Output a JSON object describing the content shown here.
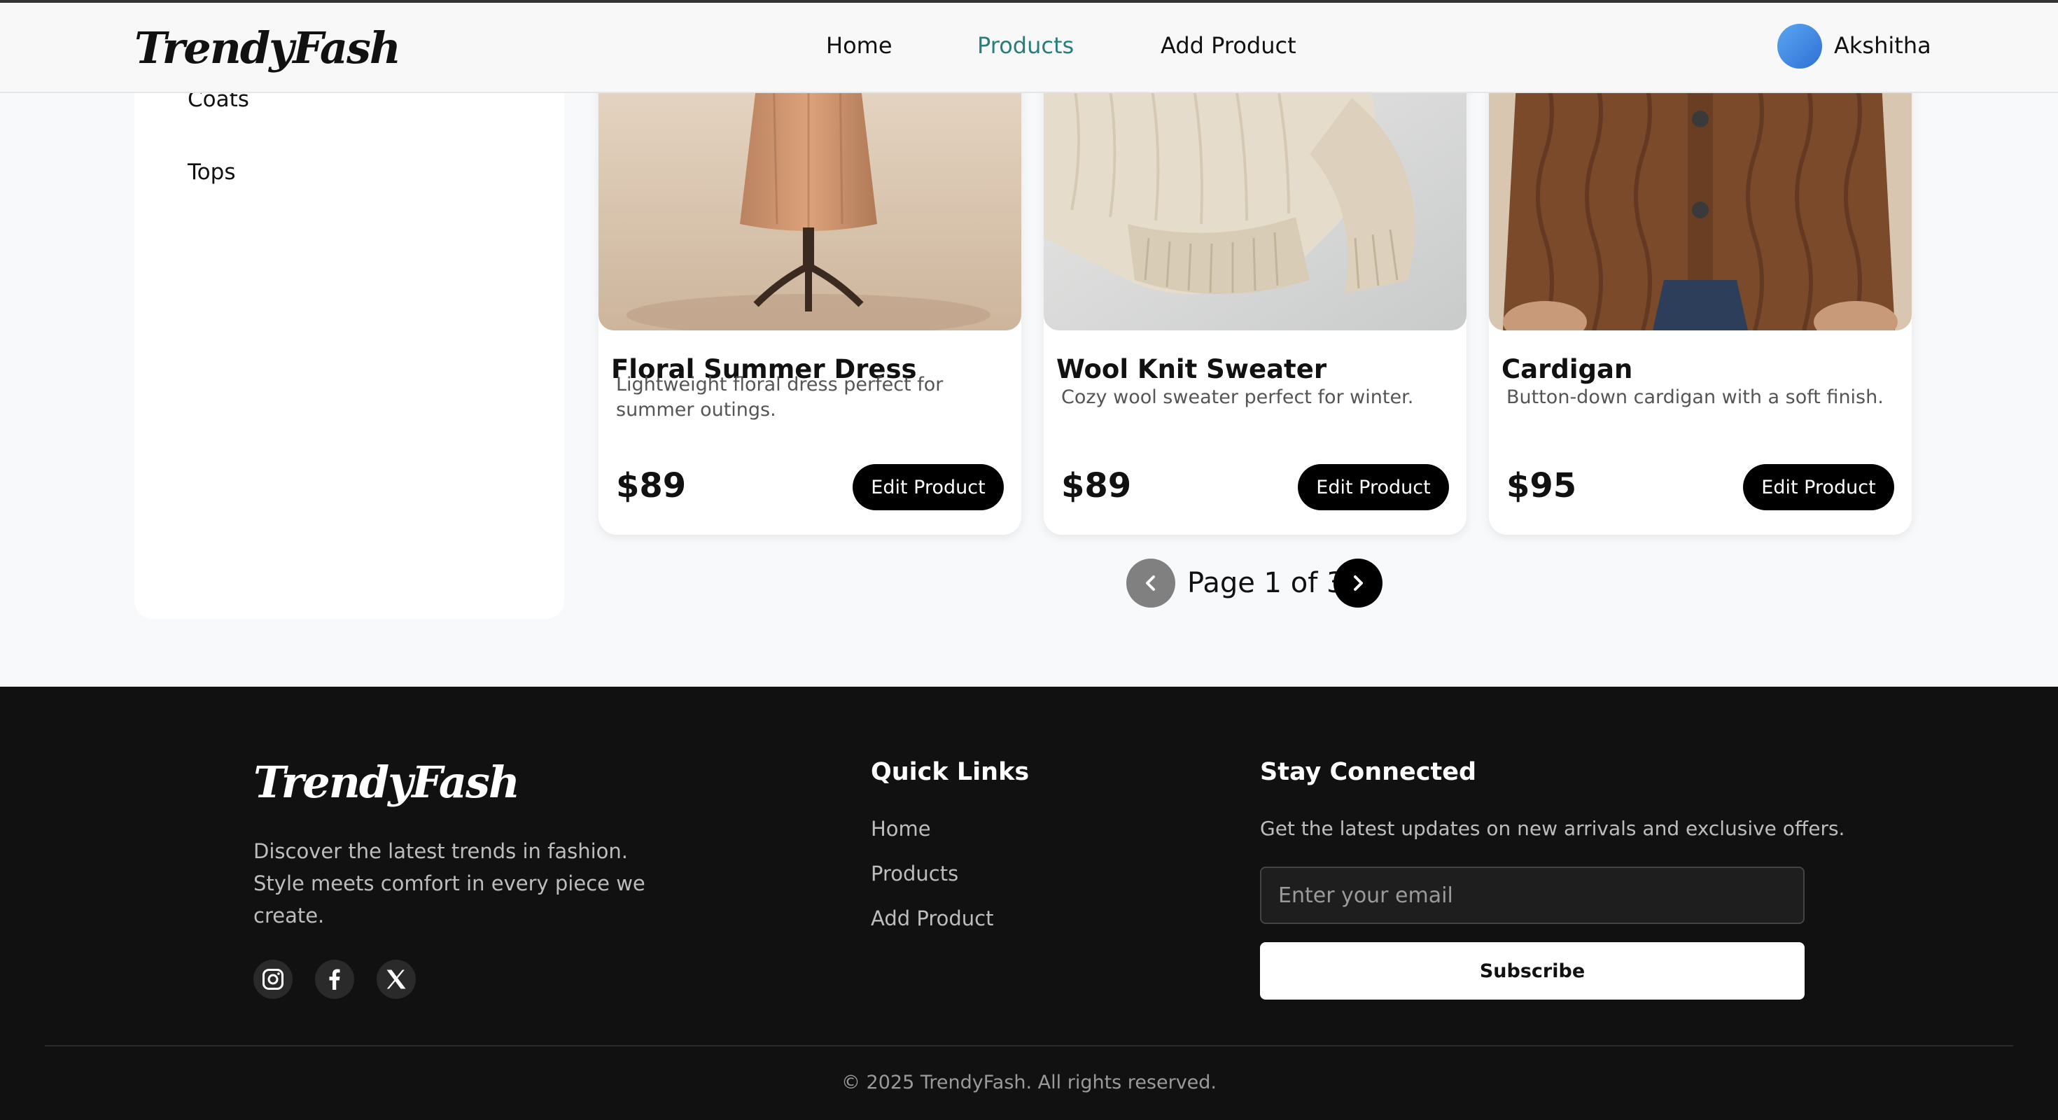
{
  "nav": {
    "logo": "TrendyFash",
    "links": [
      {
        "label": "Home"
      },
      {
        "label": "Products",
        "active": true
      },
      {
        "label": "Add Product"
      }
    ],
    "user": "Akshitha"
  },
  "sidebar": {
    "items": [
      {
        "label": "Coats"
      },
      {
        "label": "Tops"
      }
    ]
  },
  "products": [
    {
      "title": "Floral Summer Dress",
      "description": "Lightweight floral dress perfect for summer outings.",
      "price": "$89",
      "button": "Edit Product",
      "image": "dress-on-mannequin"
    },
    {
      "title": "Wool Knit Sweater",
      "description": "Cozy wool sweater perfect for winter.",
      "price": "$89",
      "button": "Edit Product",
      "image": "cream-knit-sweater"
    },
    {
      "title": "Cardigan",
      "description": "Button-down cardigan with a soft finish.",
      "price": "$95",
      "button": "Edit Product",
      "image": "brown-cable-knit-cardigan"
    }
  ],
  "pagination": {
    "text": "Page 1 of 3",
    "current": 1,
    "total": 3
  },
  "footer": {
    "logo": "TrendyFash",
    "about": "Discover the latest trends in fashion. Style meets comfort in every piece we create.",
    "social": [
      "instagram-icon",
      "facebook-icon",
      "x-icon"
    ],
    "quick_links_heading": "Quick Links",
    "quick_links": [
      {
        "label": "Home"
      },
      {
        "label": "Products"
      },
      {
        "label": "Add Product"
      }
    ],
    "stay_heading": "Stay Connected",
    "stay_text": "Get the latest updates on new arrivals and exclusive offers.",
    "email_placeholder": "Enter your email",
    "subscribe": "Subscribe",
    "copyright": "© 2025 TrendyFash. All rights reserved."
  },
  "colors": {
    "accent": "#2a7d7b",
    "footer_bg": "#111111",
    "button": "#000000"
  }
}
